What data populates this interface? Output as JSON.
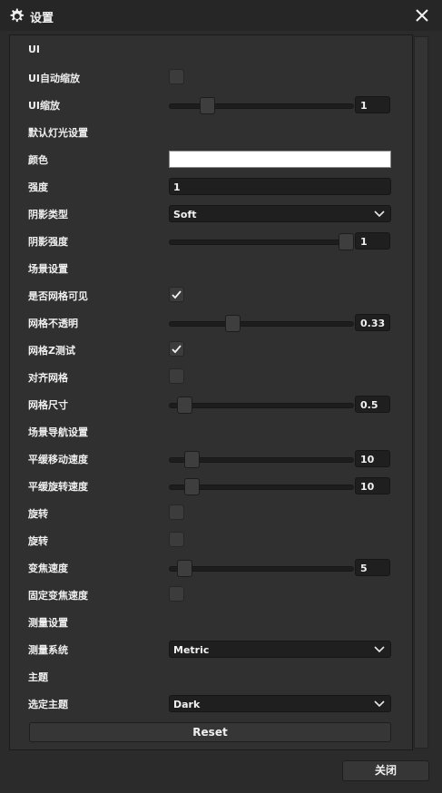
{
  "window": {
    "title": "设置",
    "icon": "gear-icon",
    "close_icon": "close-icon"
  },
  "sections": {
    "ui": "UI",
    "lighting": "默认灯光设置",
    "scene": "场景设置",
    "navigation": "场景导航设置",
    "measurement": "测量设置",
    "theme": "主题"
  },
  "settings": {
    "ui_autoscale": {
      "label": "UI自动缩放",
      "checked": false
    },
    "ui_scale": {
      "label": "UI缩放",
      "value": "1",
      "fraction": 0.18
    },
    "color": {
      "label": "颜色",
      "value": "#ffffff"
    },
    "intensity": {
      "label": "强度",
      "value": "1"
    },
    "shadow_type": {
      "label": "阴影类型",
      "value": "Soft"
    },
    "shadow_strength": {
      "label": "阴影强度",
      "value": "1",
      "fraction": 1.0
    },
    "grid_visible": {
      "label": "是否网格可见",
      "checked": true
    },
    "grid_opacity": {
      "label": "网格不透明",
      "value": "0.33",
      "fraction": 0.33
    },
    "grid_z_test": {
      "label": "网格Z测试",
      "checked": true
    },
    "snap_to_grid": {
      "label": "对齐网格",
      "checked": false
    },
    "grid_size": {
      "label": "网格尺寸",
      "value": "0.5",
      "fraction": 0.05
    },
    "pan_speed": {
      "label": "平缓移动速度",
      "value": "10",
      "fraction": 0.09
    },
    "rotate_speed": {
      "label": "平缓旋转速度",
      "value": "10",
      "fraction": 0.09
    },
    "rotate_1": {
      "label": "旋转",
      "checked": false
    },
    "rotate_2": {
      "label": "旋转",
      "checked": false
    },
    "zoom_speed": {
      "label": "变焦速度",
      "value": "5",
      "fraction": 0.05
    },
    "fixed_zoom_speed": {
      "label": "固定变焦速度",
      "checked": false
    },
    "measurement_system": {
      "label": "测量系统",
      "value": "Metric"
    },
    "selected_theme": {
      "label": "选定主题",
      "value": "Dark"
    }
  },
  "buttons": {
    "reset": "Reset",
    "close": "关闭"
  },
  "colors": {
    "background": "#2b2b2b",
    "panel": "#303030",
    "field": "#1f1f1f",
    "text": "#efefef"
  }
}
